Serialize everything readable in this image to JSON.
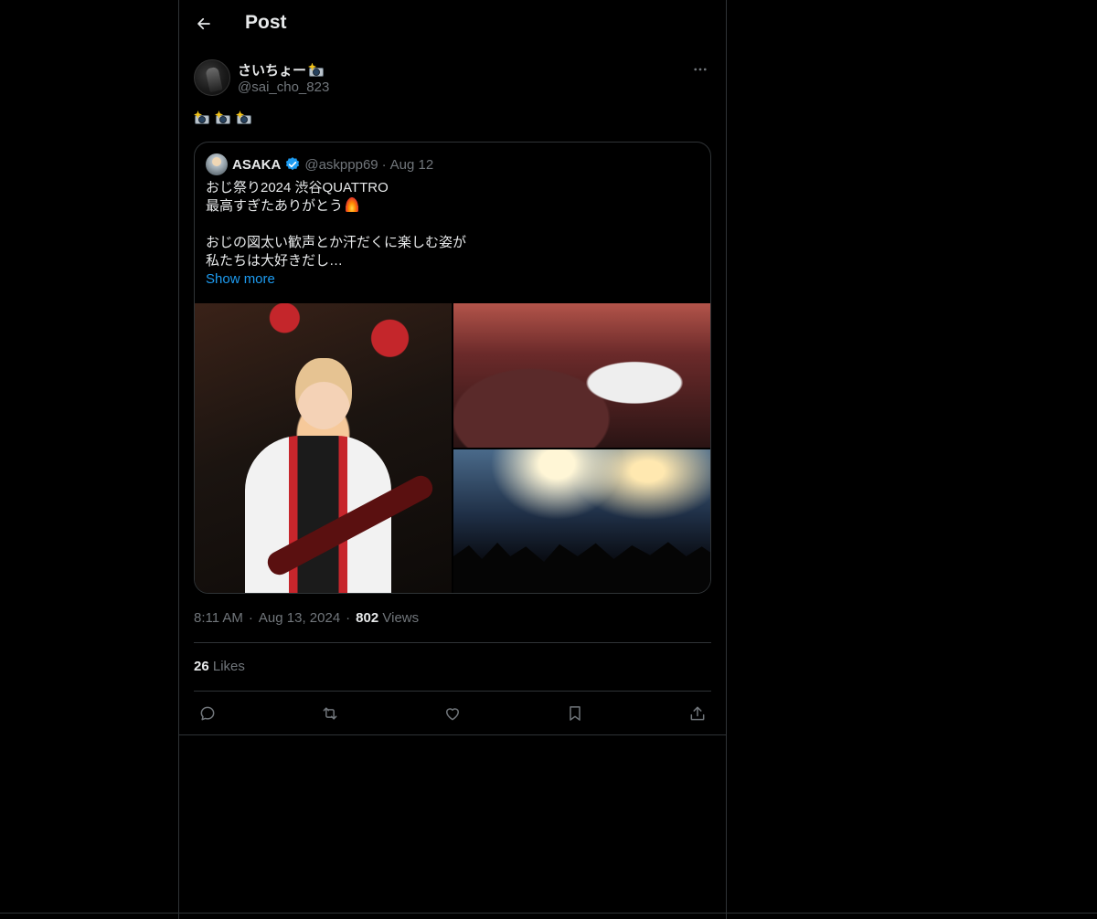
{
  "header": {
    "title": "Post"
  },
  "author": {
    "display_name": "さいちょー",
    "handle": "@sai_cho_823"
  },
  "post": {
    "emoji_icons": [
      "camera-flash-icon",
      "camera-flash-icon",
      "camera-flash-icon"
    ]
  },
  "quote": {
    "name": "ASAKA",
    "handle": "@askppp69",
    "separator": "·",
    "date": "Aug 12",
    "lines": [
      "おじ祭り2024 渋谷QUATTRO",
      "最高すぎたありがとう",
      "",
      "おじの図太い歓声とか汗だくに楽しむ姿が",
      "私たちは大好きだし…"
    ],
    "show_more": "Show more",
    "images": [
      "guitarist-on-stage",
      "crowd-from-stage",
      "stage-lights-wide"
    ]
  },
  "meta": {
    "time": "8:11 AM",
    "dot1": "·",
    "date": "Aug 13, 2024",
    "dot2": "·",
    "views_count": "802",
    "views_label": "Views"
  },
  "likes": {
    "count": "26",
    "label": "Likes"
  },
  "actions": [
    "reply-icon",
    "retweet-icon",
    "like-icon",
    "bookmark-icon",
    "share-icon"
  ],
  "colors": {
    "background": "#000000",
    "text": "#e7e9ea",
    "muted": "#71767b",
    "link": "#1d9bf0",
    "border": "#2f3336"
  }
}
